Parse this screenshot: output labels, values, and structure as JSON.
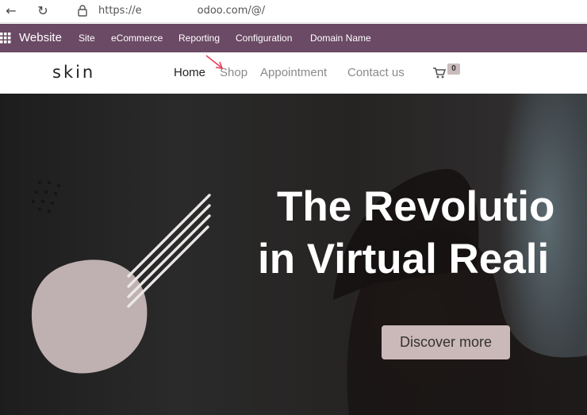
{
  "browser": {
    "back_icon": "arrow-left-icon",
    "reload_icon": "reload-icon",
    "url_prefix": "https://e",
    "url_suffix": "odoo.com/@/"
  },
  "admin_bar": {
    "title": "Website",
    "menu": [
      "Site",
      "eCommerce",
      "Reporting",
      "Configuration",
      "Domain Name"
    ],
    "background": "#6b4a65"
  },
  "site_header": {
    "logo": "skin",
    "menu": [
      "Home",
      "Shop",
      "Appointment",
      "Contact us"
    ],
    "active": "Home",
    "cart_count": "0"
  },
  "hero": {
    "title_line1": "The Revolutio",
    "title_line2": "in Virtual Reali",
    "cta": "Discover more",
    "accent": "#cbb8b8"
  }
}
